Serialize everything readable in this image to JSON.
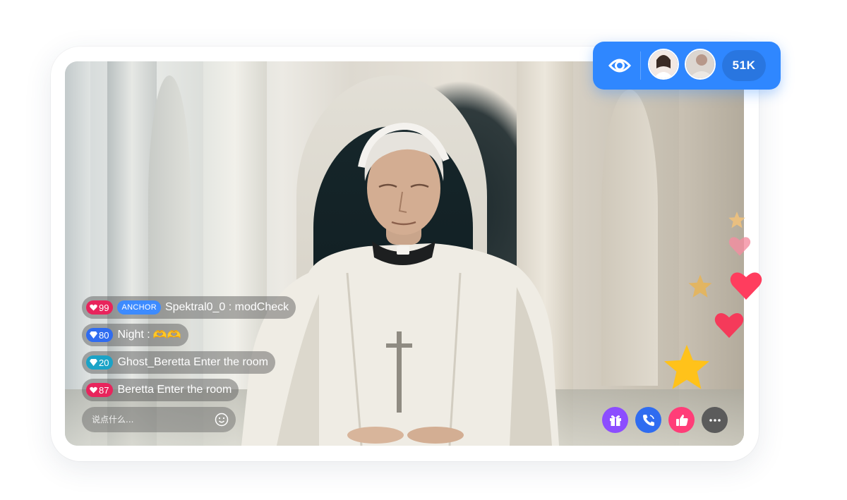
{
  "viewers": {
    "count": "51K",
    "avatars": [
      {
        "name": "viewer-avatar-1",
        "bg": "#f1e7e2"
      },
      {
        "name": "viewer-avatar-2",
        "bg": "#d9d4cf"
      }
    ]
  },
  "chat": {
    "messages": [
      {
        "level": "99",
        "level_color": "#e8245c",
        "badge": "ANCHOR",
        "user": "Spektral0_0",
        "text": "Spektral0_0 : modCheck"
      },
      {
        "level": "80",
        "level_color": "#2f6cf0",
        "text": "Night :",
        "emojis": "🫶🫶"
      },
      {
        "level": "20",
        "level_color": "#1ba3c7",
        "text": "Ghost_Beretta Enter the room"
      },
      {
        "level": "87",
        "level_color": "#e8245c",
        "text": "Beretta Enter the room"
      }
    ]
  },
  "input": {
    "placeholder": "说点什么..."
  },
  "actions": [
    {
      "name": "gift-icon",
      "color": "#8c4dff"
    },
    {
      "name": "phone-call-icon",
      "color": "#2f6cf0"
    },
    {
      "name": "thumbs-up-icon",
      "color": "#ff3d78"
    },
    {
      "name": "more-icon",
      "color": "#5b5b5b"
    }
  ],
  "colors": {
    "accent": "#2f87ff",
    "heart": "#ff3d5e",
    "star": "#ffc21a"
  }
}
